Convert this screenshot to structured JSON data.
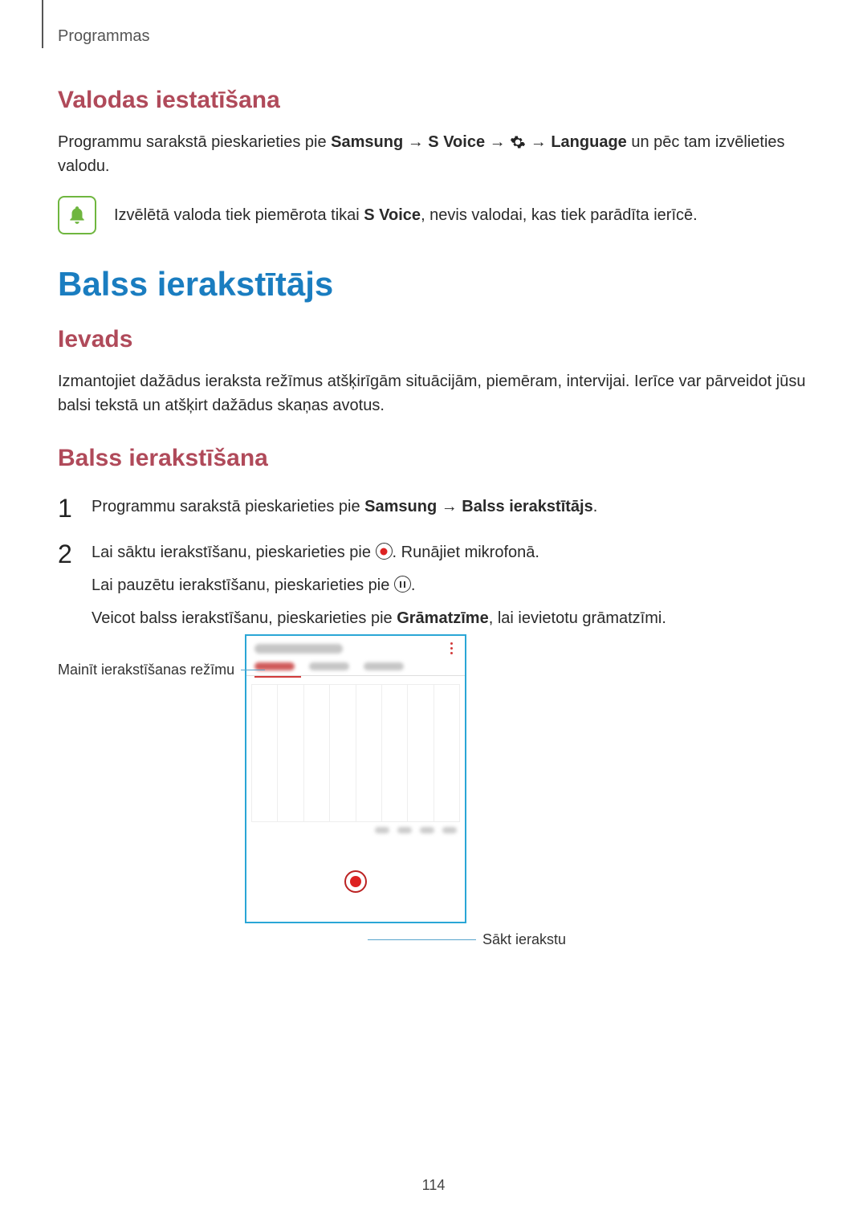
{
  "header": {
    "breadcrumb": "Programmas"
  },
  "section1": {
    "heading": "Valodas iestatīšana",
    "para_prefix": "Programmu sarakstā pieskarieties pie ",
    "bold1": "Samsung",
    "arrow": " → ",
    "bold2": "S Voice",
    "bold3": "Language",
    "para_suffix": " un pēc tam izvēlieties valodu.",
    "note_prefix": "Izvēlētā valoda tiek piemērota tikai ",
    "note_bold": "S Voice",
    "note_suffix": ", nevis valodai, kas tiek parādīta ierīcē."
  },
  "section2": {
    "title": "Balss ierakstītājs",
    "sub": "Ievads",
    "para": "Izmantojiet dažādus ieraksta režīmus atšķirīgām situācijām, piemēram, intervijai. Ierīce var pārveidot jūsu balsi tekstā un atšķirt dažādus skaņas avotus."
  },
  "section3": {
    "heading": "Balss ierakstīšana",
    "step1_prefix": "Programmu sarakstā pieskarieties pie ",
    "step1_bold1": "Samsung",
    "step1_arrow": " → ",
    "step1_bold2": "Balss ierakstītājs",
    "step1_suffix": ".",
    "step2_line1a": "Lai sāktu ierakstīšanu, pieskarieties pie ",
    "step2_line1b": ". Runājiet mikrofonā.",
    "step2_line2a": "Lai pauzētu ierakstīšanu, pieskarieties pie ",
    "step2_line2b": ".",
    "step2_line3a": "Veicot balss ierakstīšanu, pieskarieties pie ",
    "step2_line3_bold": "Grāmatzīme",
    "step2_line3b": ", lai ievietotu grāmatzīmi."
  },
  "callouts": {
    "left": "Mainīt ierakstīšanas režīmu",
    "right": "Sākt ierakstu"
  },
  "page_number": "114"
}
